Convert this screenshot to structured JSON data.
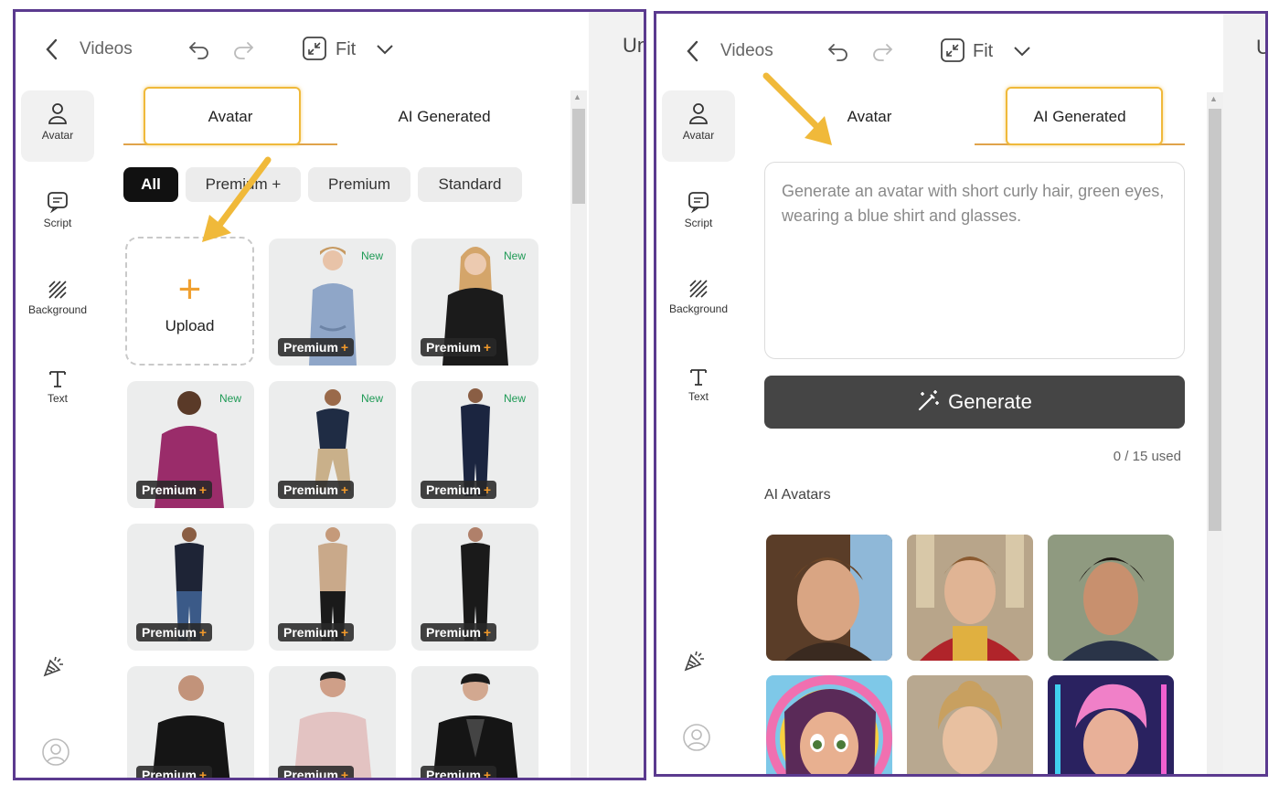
{
  "nav": {
    "back_label": "Videos",
    "fit_label": "Fit",
    "truncated_title": "Un"
  },
  "sidebar": [
    {
      "label": "Avatar",
      "icon": "person-icon"
    },
    {
      "label": "Script",
      "icon": "chat-icon"
    },
    {
      "label": "Background",
      "icon": "hatch-icon"
    },
    {
      "label": "Text",
      "icon": "text-icon"
    }
  ],
  "tabs": {
    "avatar": "Avatar",
    "ai_generated": "AI Generated"
  },
  "filters": [
    "All",
    "Premium +",
    "Premium",
    "Standard"
  ],
  "upload_label": "Upload",
  "new_label": "New",
  "badge_label": "Premium",
  "prompt_placeholder": "Generate an avatar with short curly hair, green eyes, wearing a blue shirt and glasses.",
  "generate_label": "Generate",
  "usage": "0 / 15 used",
  "ai_avatars_label": "AI Avatars",
  "colors": {
    "accent": "#f0b93a",
    "border": "#5b3a8f",
    "new_text": "#1e9a55",
    "button": "#454545"
  }
}
